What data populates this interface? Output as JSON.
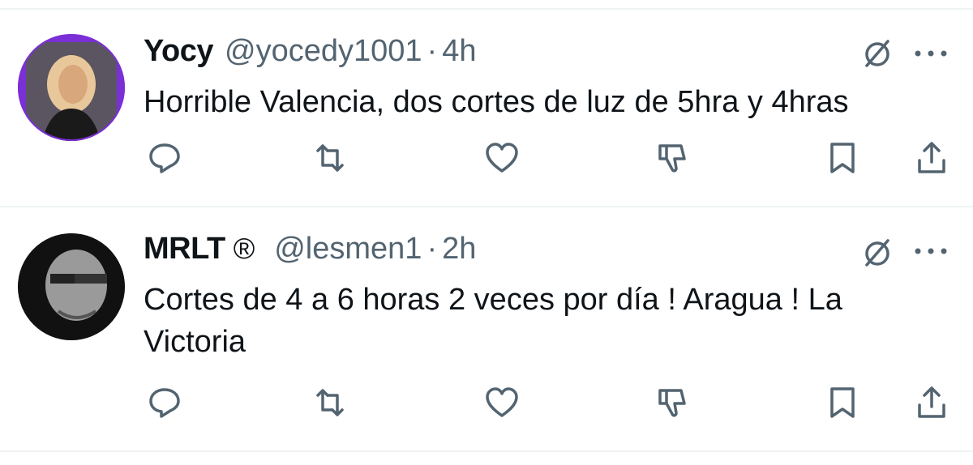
{
  "tweets": [
    {
      "display_name": "Yocy",
      "handle": "@yocedy1001",
      "separator": "·",
      "time": "4h",
      "badge": "",
      "text": "Horrible Valencia, dos cortes de luz de 5hra y 4hras",
      "avatar_colors": {
        "ring": "#7b2fd6",
        "skin": "#d9a77c",
        "hair": "#e8c89a",
        "shirt": "#1a1a1a"
      }
    },
    {
      "display_name": "MRLT",
      "handle": "@lesmen1",
      "separator": "·",
      "time": "2h",
      "badge": "®",
      "text": "Cortes de 4 a 6 horas 2 veces por día ! Aragua ! La Victoria",
      "avatar_colors": {
        "ring": "#111111",
        "face": "#9a9a9a"
      }
    }
  ],
  "icons": {
    "reply": "reply-icon",
    "repost": "repost-icon",
    "like": "like-icon",
    "downvote": "downvote-icon",
    "bookmark": "bookmark-icon",
    "share": "share-icon",
    "grok": "grok-icon",
    "more": "more-icon"
  },
  "colors": {
    "icon": "#536471",
    "text": "#0f1419",
    "divider": "#eff3f4"
  }
}
